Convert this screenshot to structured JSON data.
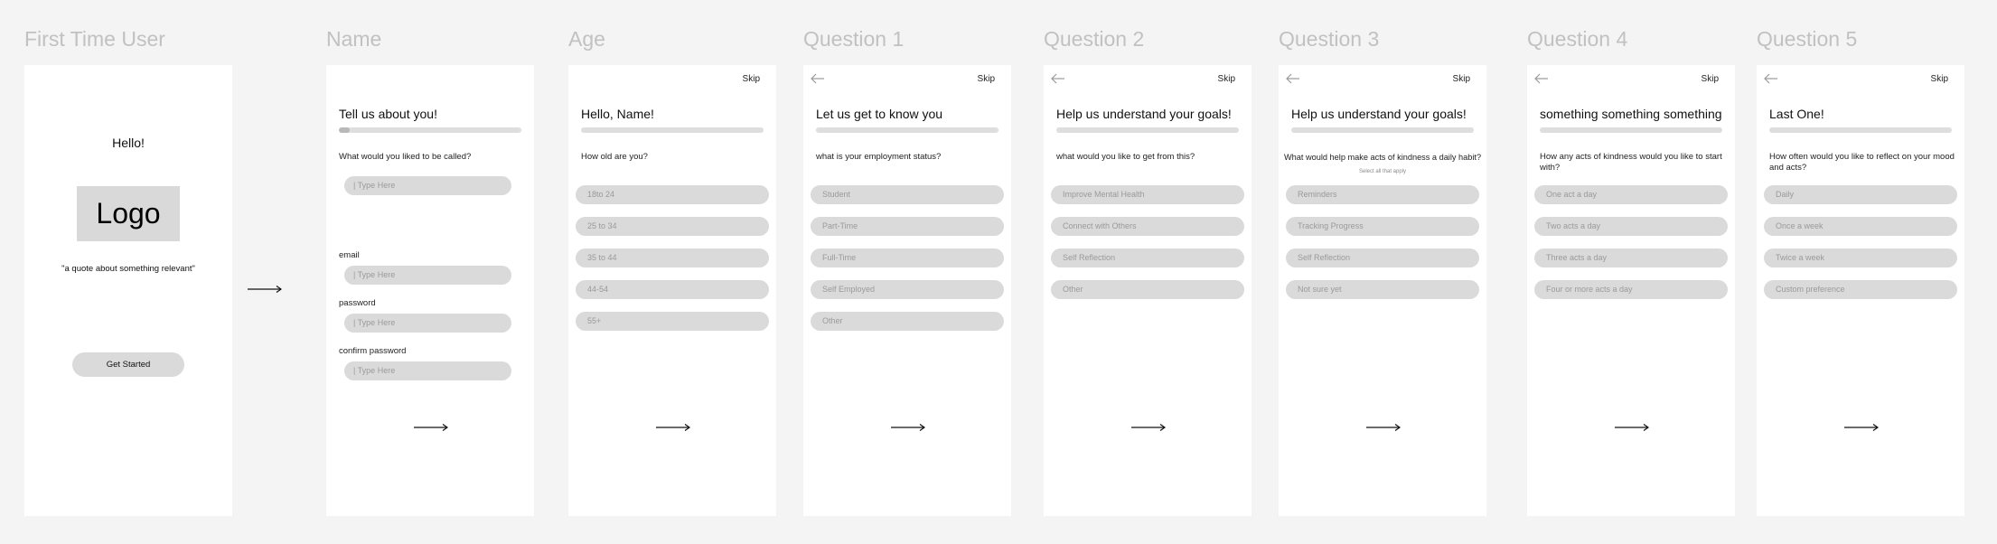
{
  "frames": {
    "first_time": {
      "title": "First Time User",
      "greeting": "Hello!",
      "logo": "Logo",
      "quote": "\"a quote about something relevant\"",
      "cta": "Get Started"
    },
    "name": {
      "title": "Name",
      "heading": "Tell us about you!",
      "progress": 0.06,
      "question": "What would you liked to be called?",
      "placeholder": "| Type Here",
      "email_label": "email",
      "password_label": "password",
      "confirm_label": "confirm password"
    },
    "age": {
      "title": "Age",
      "skip": "Skip",
      "heading": "Hello, Name!",
      "progress": 0,
      "question": "How old are you?",
      "options": [
        "18to 24",
        "25 to 34",
        "35 to 44",
        "44-54",
        "55+"
      ]
    },
    "q1": {
      "title": "Question 1",
      "skip": "Skip",
      "heading": "Let us get to know you",
      "progress": 0,
      "question": "what is your employment status?",
      "options": [
        "Student",
        "Part-Time",
        "Full-Time",
        "Self Employed",
        "Other"
      ]
    },
    "q2": {
      "title": "Question 2",
      "skip": "Skip",
      "heading": "Help us understand your goals!",
      "progress": 0,
      "question": "what would you like to get from this?",
      "options": [
        "Improve Mental Health",
        "Connect with Others",
        "Self Reflection",
        "Other"
      ]
    },
    "q3": {
      "title": "Question 3",
      "skip": "Skip",
      "heading": "Help us understand your goals!",
      "progress": 0,
      "question": "What would help make acts of kindness a daily habit?",
      "sub": "Select all that apply",
      "options": [
        "Reminders",
        "Tracking Progress",
        "Self Reflection",
        "Not sure yet"
      ]
    },
    "q4": {
      "title": "Question 4",
      "skip": "Skip",
      "heading": "something something something",
      "progress": 0,
      "question": "How any acts of kindness would you like to start with?",
      "options": [
        "One act a day",
        "Two acts a day",
        "Three acts a day",
        "Four or more acts a day"
      ]
    },
    "q5": {
      "title": "Question 5",
      "skip": "Skip",
      "heading": "Last One!",
      "progress": 0,
      "question": "How often would you like to reflect on your mood and acts?",
      "options": [
        "Daily",
        "Once a week",
        "Twice a week",
        "Custom preference"
      ]
    }
  },
  "icons": {
    "back": "back-arrow-icon",
    "next": "next-arrow-icon",
    "flow": "flow-arrow-icon"
  },
  "colors": {
    "background": "#f4f4f4",
    "frame": "#ffffff",
    "pill": "#dadada",
    "title": "#c1c1c1"
  }
}
